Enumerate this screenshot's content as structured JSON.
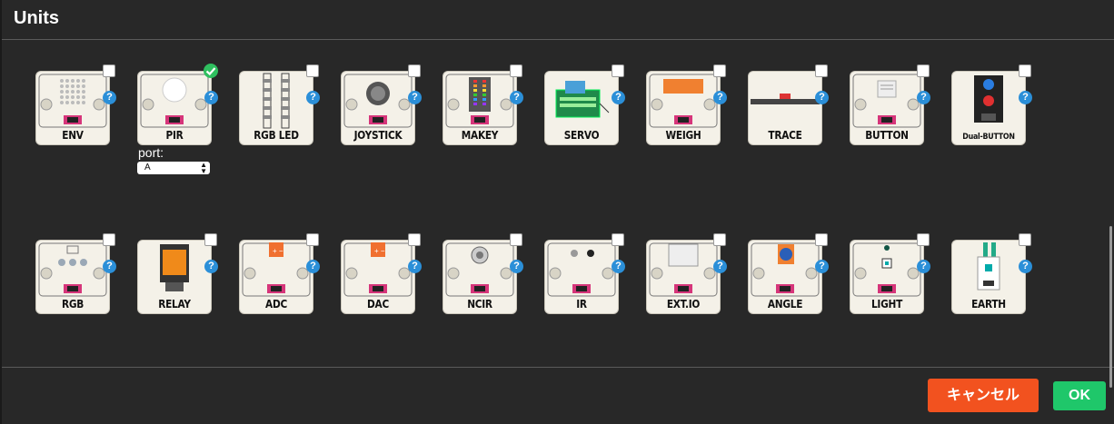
{
  "dialog": {
    "title": "Units"
  },
  "units": [
    {
      "label": "ENV",
      "checked": false,
      "icon": "env-module-icon"
    },
    {
      "label": "PIR",
      "checked": true,
      "icon": "pir-module-icon"
    },
    {
      "label": "RGB LED",
      "checked": false,
      "icon": "rgb-led-strip-icon"
    },
    {
      "label": "JOYSTICK",
      "checked": false,
      "icon": "joystick-module-icon"
    },
    {
      "label": "MAKEY",
      "checked": false,
      "icon": "makey-module-icon"
    },
    {
      "label": "SERVO",
      "checked": false,
      "icon": "servo-module-icon"
    },
    {
      "label": "WEIGH",
      "checked": false,
      "icon": "weigh-module-icon"
    },
    {
      "label": "TRACE",
      "checked": false,
      "icon": "trace-module-icon"
    },
    {
      "label": "BUTTON",
      "checked": false,
      "icon": "button-module-icon"
    },
    {
      "label": "Dual-BUTTON",
      "checked": false,
      "icon": "dual-button-module-icon"
    },
    {
      "label": "RGB",
      "checked": false,
      "icon": "rgb-module-icon"
    },
    {
      "label": "RELAY",
      "checked": false,
      "icon": "relay-module-icon"
    },
    {
      "label": "ADC",
      "checked": false,
      "icon": "adc-module-icon"
    },
    {
      "label": "DAC",
      "checked": false,
      "icon": "dac-module-icon"
    },
    {
      "label": "NCIR",
      "checked": false,
      "icon": "ncir-module-icon"
    },
    {
      "label": "IR",
      "checked": false,
      "icon": "ir-module-icon"
    },
    {
      "label": "EXT.IO",
      "checked": false,
      "icon": "ext-io-module-icon"
    },
    {
      "label": "ANGLE",
      "checked": false,
      "icon": "angle-module-icon"
    },
    {
      "label": "LIGHT",
      "checked": false,
      "icon": "light-module-icon"
    },
    {
      "label": "EARTH",
      "checked": false,
      "icon": "earth-module-icon"
    }
  ],
  "help_glyph": "?",
  "port": {
    "label": "port:",
    "value": "A"
  },
  "buttons": {
    "cancel": "キャンセル",
    "ok": "OK"
  },
  "colors": {
    "cancel": "#f2521f",
    "ok": "#1fc76a",
    "help": "#2b8fd8",
    "check": "#2fbf5f"
  }
}
